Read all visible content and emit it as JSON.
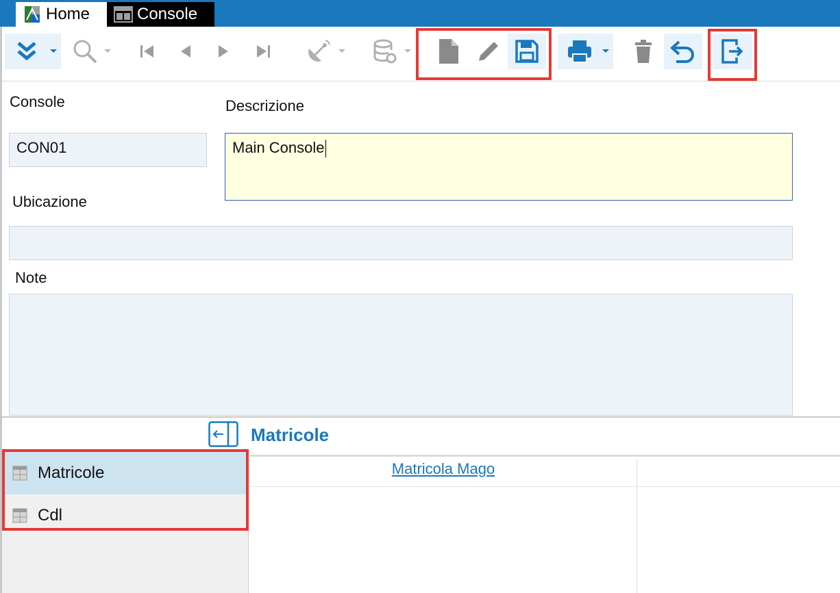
{
  "tabs": [
    {
      "label": "Home",
      "icon": "app-logo-icon"
    },
    {
      "label": "Console",
      "icon": "console-window-icon"
    }
  ],
  "toolbar": {
    "buttons": [
      "expand",
      "search",
      "first",
      "previous",
      "next",
      "last",
      "radar",
      "database",
      "new",
      "edit",
      "save",
      "print",
      "delete",
      "undo",
      "exit"
    ],
    "accent": "#1a78bd",
    "disabled": "#9e9e9e",
    "highlight": "#e53935"
  },
  "form": {
    "console_label": "Console",
    "console_value": "CON01",
    "descrizione_label": "Descrizione",
    "descrizione_value": "Main Console",
    "ubicazione_label": "Ubicazione",
    "ubicazione_value": "",
    "note_label": "Note",
    "note_value": ""
  },
  "detail": {
    "title": "Matricole",
    "sidebar": [
      {
        "label": "Matricole",
        "selected": true
      },
      {
        "label": "Cdl",
        "selected": false
      }
    ],
    "columns": [
      "Matricola Mago"
    ]
  }
}
